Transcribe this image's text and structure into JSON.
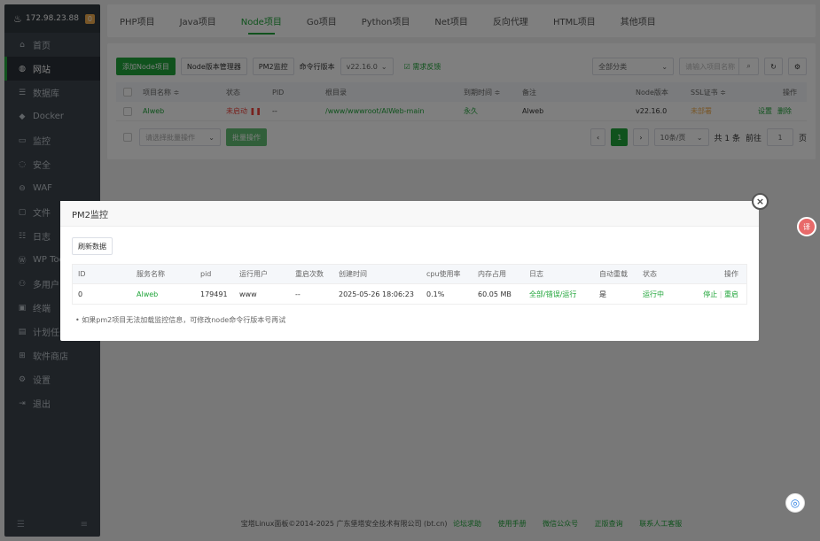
{
  "sidebar": {
    "ip": "172.98.23.88",
    "badge": "0",
    "items": [
      {
        "label": "首页"
      },
      {
        "label": "网站"
      },
      {
        "label": "数据库"
      },
      {
        "label": "Docker"
      },
      {
        "label": "监控"
      },
      {
        "label": "安全"
      },
      {
        "label": "WAF"
      },
      {
        "label": "文件"
      },
      {
        "label": "日志"
      },
      {
        "label": "WP Too"
      },
      {
        "label": "多用户"
      },
      {
        "label": "终端"
      },
      {
        "label": "计划任务"
      },
      {
        "label": "软件商店"
      },
      {
        "label": "设置"
      },
      {
        "label": "退出"
      }
    ]
  },
  "tabs": [
    "PHP项目",
    "Java项目",
    "Node项目",
    "Go项目",
    "Python项目",
    "Net项目",
    "反向代理",
    "HTML项目",
    "其他项目"
  ],
  "toolbar": {
    "add_label": "添加Node项目",
    "version_mgr": "Node版本管理器",
    "pm2": "PM2监控",
    "cmd_label": "命令行版本",
    "cmd_version": "v22.16.0",
    "feedback": "需求反馈",
    "category": "全部分类",
    "search_placeholder": "请输入项目名称"
  },
  "table": {
    "headers": [
      "项目名称 ≑",
      "状态",
      "PID",
      "根目录",
      "到期时间 ≑",
      "备注",
      "Node版本",
      "SSL证书 ≑",
      "操作"
    ],
    "row": {
      "name": "Alweb",
      "status": "未启动",
      "pid": "--",
      "root": "/www/wwwroot/AIWeb-main",
      "expire": "永久",
      "remark": "Alweb",
      "node": "v22.16.0",
      "ssl": "未部署",
      "op_set": "设置",
      "op_del": "删除"
    }
  },
  "pager": {
    "batch_placeholder": "请选择批量操作",
    "batch_btn": "批量操作",
    "page": "1",
    "per_page": "10条/页",
    "total": "共 1 条",
    "goto": "前往",
    "goto_page": "1",
    "page_unit": "页"
  },
  "footer": {
    "copyright": "宝塔Linux面板©2014-2025 广东堡塔安全技术有限公司 (bt.cn)",
    "links": [
      "论坛求助",
      "使用手册",
      "微信公众号",
      "正版查询",
      "联系人工客服"
    ]
  },
  "modal": {
    "title": "PM2监控",
    "refresh": "刷新数据",
    "headers": [
      "ID",
      "服务名称",
      "pid",
      "运行用户",
      "重启次数",
      "创建时间",
      "cpu使用率",
      "内存占用",
      "日志",
      "自动重载",
      "状态",
      "操作"
    ],
    "row": {
      "id": "0",
      "name": "Alweb",
      "pid": "179491",
      "user": "www",
      "restarts": "--",
      "created": "2025-05-26 18:06:23",
      "cpu": "0.1%",
      "mem": "60.05 MB",
      "log": "全部/错误/运行",
      "reload": "是",
      "status": "运行中",
      "stop": "停止",
      "restart": "重启"
    },
    "note": "如果pm2项目无法加载监控信息，可修改node命令行版本号再试"
  }
}
